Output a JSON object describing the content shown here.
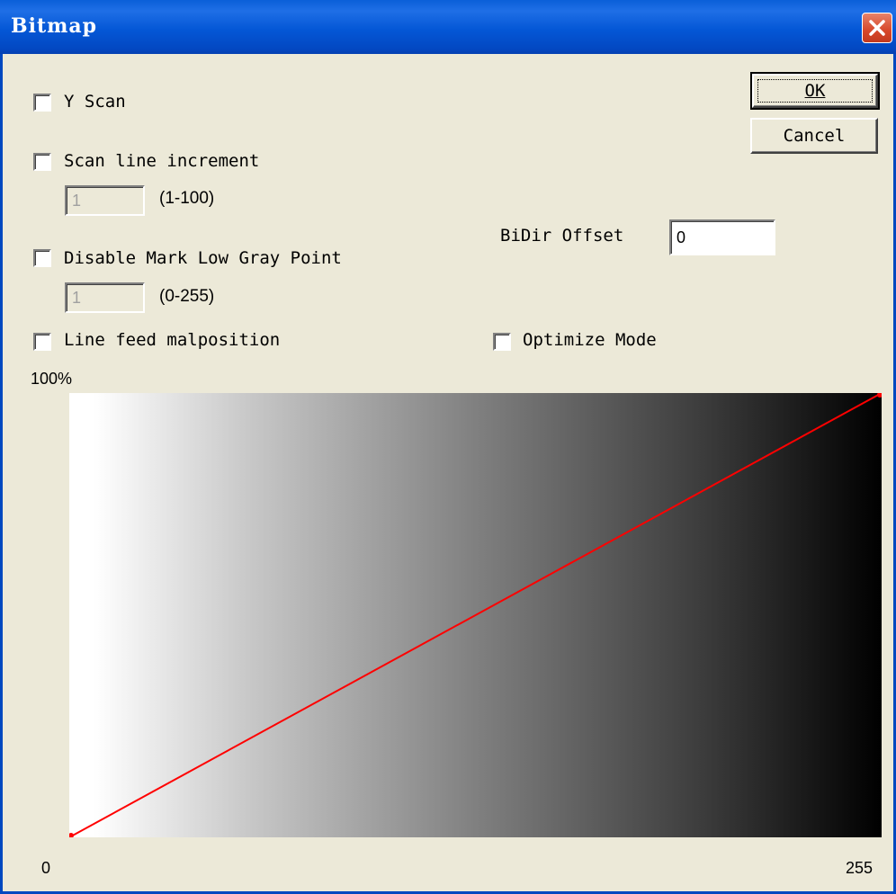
{
  "window": {
    "title": "Bitmap"
  },
  "buttons": {
    "ok": "OK",
    "cancel": "Cancel"
  },
  "options": {
    "y_scan": {
      "label": "Y Scan",
      "checked": false
    },
    "scan_line_increment": {
      "label": "Scan line increment",
      "checked": false,
      "value": "1",
      "range": "(1-100)"
    },
    "disable_mark_low_gray": {
      "label": "Disable Mark Low Gray Point",
      "checked": false,
      "value": "1",
      "range": "(0-255)"
    },
    "line_feed_malposition": {
      "label": "Line feed malposition",
      "checked": false
    },
    "optimize_mode": {
      "label": "Optimize Mode",
      "checked": false
    },
    "bidir_offset": {
      "label": "BiDir Offset",
      "value": "0"
    }
  },
  "curve": {
    "y_max_label": "100%",
    "x_min_label": "0",
    "x_max_label": "255",
    "points": [
      [
        0,
        0
      ],
      [
        255,
        100
      ]
    ],
    "line_color": "#ff0000",
    "gradient": "white-to-black"
  },
  "colors": {
    "titlebar": "#0457d6",
    "dialog_bg": "#ece9d8",
    "close": "#d7472a"
  }
}
